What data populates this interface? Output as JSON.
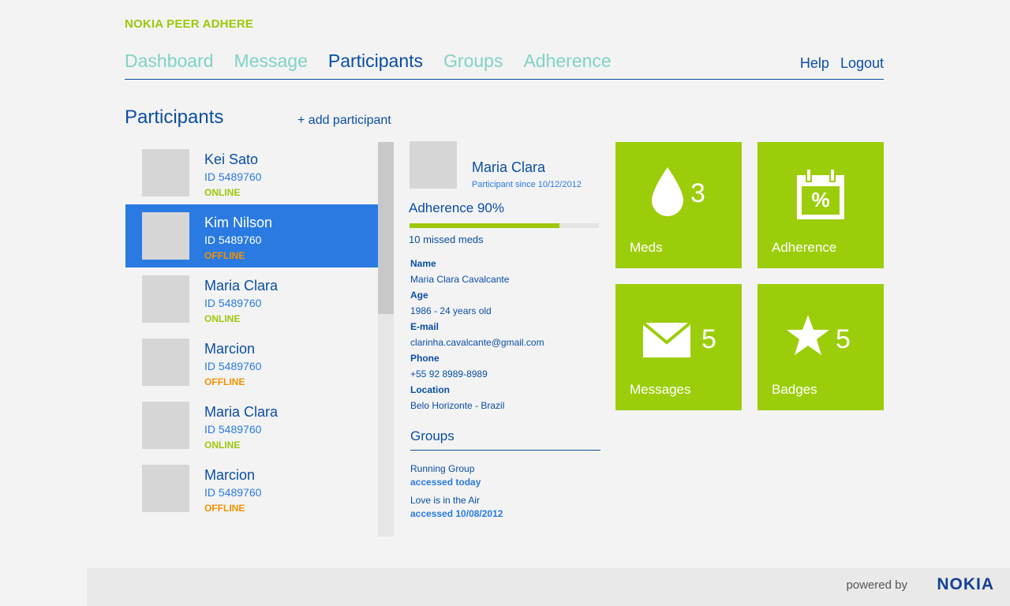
{
  "app": {
    "title": "NOKIA PEER ADHERE"
  },
  "nav": {
    "items": [
      "Dashboard",
      "Message",
      "Participants",
      "Groups",
      "Adherence"
    ],
    "active": "Participants",
    "help": "Help",
    "logout": "Logout"
  },
  "page": {
    "title": "Participants",
    "add_label": "+ add participant"
  },
  "participants": [
    {
      "name": "Kei Sato",
      "id": "ID 5489760",
      "status": "ONLINE"
    },
    {
      "name": "Kim Nilson",
      "id": "ID 5489760",
      "status": "OFFLINE"
    },
    {
      "name": "Maria Clara",
      "id": "ID 5489760",
      "status": "ONLINE"
    },
    {
      "name": "Marcion",
      "id": "ID 5489760",
      "status": "OFFLINE"
    },
    {
      "name": "Maria Clara",
      "id": "ID 5489760",
      "status": "ONLINE"
    },
    {
      "name": "Marcion",
      "id": "ID 5489760",
      "status": "OFFLINE"
    }
  ],
  "selected_participant_index": 1,
  "detail": {
    "name": "Maria Clara",
    "since": "Participant since 10/12/2012",
    "adherence_label": "Adherence 90%",
    "adherence_fraction": 0.79,
    "missed": "10 missed meds",
    "fields": [
      {
        "label": "Name",
        "value": "Maria Clara Cavalcante"
      },
      {
        "label": "Age",
        "value": "1986 - 24 years old"
      },
      {
        "label": "E-mail",
        "value": "clarinha.cavalcante@gmail.com"
      },
      {
        "label": "Phone",
        "value": "+55 92 8989-8989"
      },
      {
        "label": "Location",
        "value": "Belo Horizonte - Brazil"
      }
    ],
    "groups_title": "Groups",
    "groups": [
      {
        "name": "Running Group",
        "access": "accessed today"
      },
      {
        "name": "Love is in the Air",
        "access": "accessed 10/08/2012"
      }
    ]
  },
  "tiles": {
    "meds": {
      "label": "Meds",
      "count": "3",
      "icon": "drop-icon"
    },
    "adherence": {
      "label": "Adherence",
      "icon": "calendar-percent-icon",
      "icon_text": "%"
    },
    "messages": {
      "label": "Messages",
      "count": "5",
      "icon": "envelope-icon"
    },
    "badges": {
      "label": "Badges",
      "count": "5",
      "icon": "star-icon"
    }
  },
  "footer": {
    "powered": "powered by",
    "brand": "NOKIA"
  },
  "colors": {
    "brand_green": "#9ec70a",
    "tile_green": "#9ccd0a",
    "primary_blue": "#0a4ea5",
    "accent_blue": "#2a7ae2",
    "nav_inactive": "#7fd3c6",
    "offline_orange": "#f39200"
  }
}
